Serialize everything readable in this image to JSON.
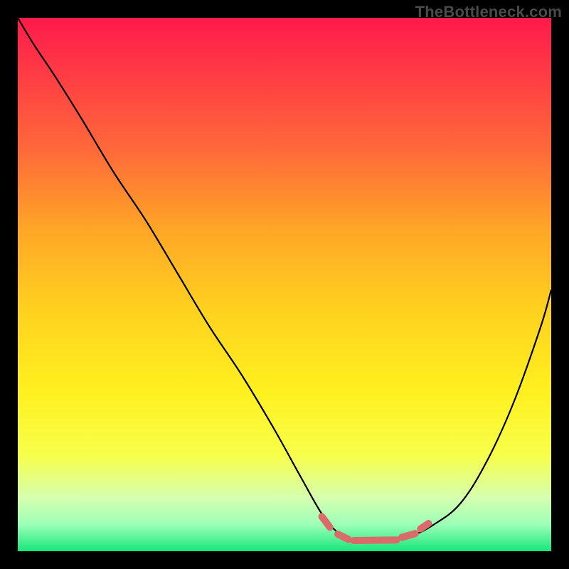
{
  "watermark": "TheBottleneck.com",
  "chart_data": {
    "type": "line",
    "title": "",
    "xlabel": "",
    "ylabel": "",
    "xlim": [
      0,
      100
    ],
    "ylim": [
      0,
      100
    ],
    "gradient_stops": [
      {
        "offset": 0,
        "color": "#ff1a4b"
      },
      {
        "offset": 10,
        "color": "#ff3a45"
      },
      {
        "offset": 25,
        "color": "#ff6a3a"
      },
      {
        "offset": 40,
        "color": "#ffa726"
      },
      {
        "offset": 55,
        "color": "#ffd21f"
      },
      {
        "offset": 70,
        "color": "#fff01f"
      },
      {
        "offset": 82,
        "color": "#f7ff4a"
      },
      {
        "offset": 90,
        "color": "#d6ffb0"
      },
      {
        "offset": 95,
        "color": "#9cffb8"
      },
      {
        "offset": 100,
        "color": "#17e67a"
      }
    ],
    "series": [
      {
        "name": "bottleneck-curve",
        "stroke": "#000000",
        "stroke_width": 2.2,
        "x": [
          0,
          3,
          7,
          12,
          18,
          24,
          30,
          36,
          42,
          48,
          53,
          57,
          60,
          63,
          66,
          70,
          74,
          78,
          83,
          88,
          93,
          98,
          100
        ],
        "y": [
          100,
          95,
          89,
          81,
          71,
          62,
          52,
          42,
          33,
          23,
          14,
          7,
          3.5,
          2,
          2,
          2.2,
          3,
          5,
          9,
          17,
          28,
          42,
          49
        ]
      },
      {
        "name": "optimal-range-marker",
        "stroke": "#db6b6b",
        "stroke_width": 10,
        "linecap": "round",
        "segments": [
          {
            "x": [
              57,
              58.5
            ],
            "y": [
              6.5,
              4.5
            ]
          },
          {
            "x": [
              60,
              62
            ],
            "y": [
              3.2,
              2.2
            ]
          },
          {
            "x": [
              63,
              71
            ],
            "y": [
              2.0,
              2.1
            ]
          },
          {
            "x": [
              72,
              74.5
            ],
            "y": [
              2.6,
              3.3
            ]
          },
          {
            "x": [
              75.5,
              77
            ],
            "y": [
              4.2,
              5.2
            ]
          }
        ]
      }
    ]
  }
}
